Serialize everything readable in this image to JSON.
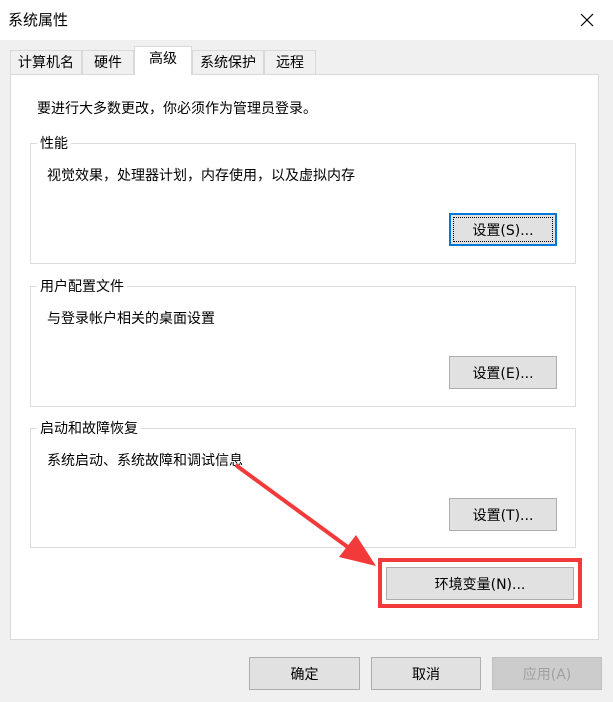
{
  "window": {
    "title": "系统属性"
  },
  "tabs": [
    {
      "label": "计算机名",
      "active": false
    },
    {
      "label": "硬件",
      "active": false
    },
    {
      "label": "高级",
      "active": true
    },
    {
      "label": "系统保护",
      "active": false
    },
    {
      "label": "远程",
      "active": false
    }
  ],
  "notice": "要进行大多数更改，你必须作为管理员登录。",
  "groups": {
    "performance": {
      "label": "性能",
      "desc": "视觉效果，处理器计划，内存使用，以及虚拟内存",
      "button": "设置(S)..."
    },
    "profile": {
      "label": "用户配置文件",
      "desc": "与登录帐户相关的桌面设置",
      "button": "设置(E)..."
    },
    "startup": {
      "label": "启动和故障恢复",
      "desc": "系统启动、系统故障和调试信息",
      "button": "设置(T)..."
    }
  },
  "env_button": "环境变量(N)...",
  "footer": {
    "ok": "确定",
    "cancel": "取消",
    "apply": "应用(A)"
  },
  "annotation": {
    "highlight_color": "#f23a3a"
  }
}
